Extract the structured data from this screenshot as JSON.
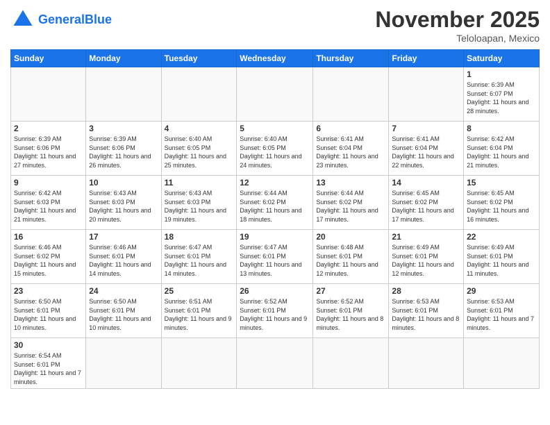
{
  "header": {
    "logo_general": "General",
    "logo_blue": "Blue",
    "month_title": "November 2025",
    "location": "Teloloapan, Mexico"
  },
  "weekdays": [
    "Sunday",
    "Monday",
    "Tuesday",
    "Wednesday",
    "Thursday",
    "Friday",
    "Saturday"
  ],
  "days": {
    "1": {
      "sunrise": "6:39 AM",
      "sunset": "6:07 PM",
      "daylight": "11 hours and 28 minutes."
    },
    "2": {
      "sunrise": "6:39 AM",
      "sunset": "6:06 PM",
      "daylight": "11 hours and 27 minutes."
    },
    "3": {
      "sunrise": "6:39 AM",
      "sunset": "6:06 PM",
      "daylight": "11 hours and 26 minutes."
    },
    "4": {
      "sunrise": "6:40 AM",
      "sunset": "6:05 PM",
      "daylight": "11 hours and 25 minutes."
    },
    "5": {
      "sunrise": "6:40 AM",
      "sunset": "6:05 PM",
      "daylight": "11 hours and 24 minutes."
    },
    "6": {
      "sunrise": "6:41 AM",
      "sunset": "6:04 PM",
      "daylight": "11 hours and 23 minutes."
    },
    "7": {
      "sunrise": "6:41 AM",
      "sunset": "6:04 PM",
      "daylight": "11 hours and 22 minutes."
    },
    "8": {
      "sunrise": "6:42 AM",
      "sunset": "6:04 PM",
      "daylight": "11 hours and 21 minutes."
    },
    "9": {
      "sunrise": "6:42 AM",
      "sunset": "6:03 PM",
      "daylight": "11 hours and 21 minutes."
    },
    "10": {
      "sunrise": "6:43 AM",
      "sunset": "6:03 PM",
      "daylight": "11 hours and 20 minutes."
    },
    "11": {
      "sunrise": "6:43 AM",
      "sunset": "6:03 PM",
      "daylight": "11 hours and 19 minutes."
    },
    "12": {
      "sunrise": "6:44 AM",
      "sunset": "6:02 PM",
      "daylight": "11 hours and 18 minutes."
    },
    "13": {
      "sunrise": "6:44 AM",
      "sunset": "6:02 PM",
      "daylight": "11 hours and 17 minutes."
    },
    "14": {
      "sunrise": "6:45 AM",
      "sunset": "6:02 PM",
      "daylight": "11 hours and 17 minutes."
    },
    "15": {
      "sunrise": "6:45 AM",
      "sunset": "6:02 PM",
      "daylight": "11 hours and 16 minutes."
    },
    "16": {
      "sunrise": "6:46 AM",
      "sunset": "6:02 PM",
      "daylight": "11 hours and 15 minutes."
    },
    "17": {
      "sunrise": "6:46 AM",
      "sunset": "6:01 PM",
      "daylight": "11 hours and 14 minutes."
    },
    "18": {
      "sunrise": "6:47 AM",
      "sunset": "6:01 PM",
      "daylight": "11 hours and 14 minutes."
    },
    "19": {
      "sunrise": "6:47 AM",
      "sunset": "6:01 PM",
      "daylight": "11 hours and 13 minutes."
    },
    "20": {
      "sunrise": "6:48 AM",
      "sunset": "6:01 PM",
      "daylight": "11 hours and 12 minutes."
    },
    "21": {
      "sunrise": "6:49 AM",
      "sunset": "6:01 PM",
      "daylight": "11 hours and 12 minutes."
    },
    "22": {
      "sunrise": "6:49 AM",
      "sunset": "6:01 PM",
      "daylight": "11 hours and 11 minutes."
    },
    "23": {
      "sunrise": "6:50 AM",
      "sunset": "6:01 PM",
      "daylight": "11 hours and 10 minutes."
    },
    "24": {
      "sunrise": "6:50 AM",
      "sunset": "6:01 PM",
      "daylight": "11 hours and 10 minutes."
    },
    "25": {
      "sunrise": "6:51 AM",
      "sunset": "6:01 PM",
      "daylight": "11 hours and 9 minutes."
    },
    "26": {
      "sunrise": "6:52 AM",
      "sunset": "6:01 PM",
      "daylight": "11 hours and 9 minutes."
    },
    "27": {
      "sunrise": "6:52 AM",
      "sunset": "6:01 PM",
      "daylight": "11 hours and 8 minutes."
    },
    "28": {
      "sunrise": "6:53 AM",
      "sunset": "6:01 PM",
      "daylight": "11 hours and 8 minutes."
    },
    "29": {
      "sunrise": "6:53 AM",
      "sunset": "6:01 PM",
      "daylight": "11 hours and 7 minutes."
    },
    "30": {
      "sunrise": "6:54 AM",
      "sunset": "6:01 PM",
      "daylight": "11 hours and 7 minutes."
    }
  },
  "labels": {
    "sunrise": "Sunrise:",
    "sunset": "Sunset:",
    "daylight": "Daylight:"
  }
}
